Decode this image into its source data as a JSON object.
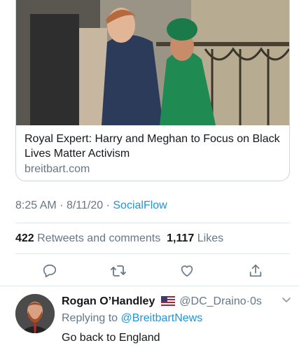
{
  "card": {
    "image_alt": "Harry and Meghan photo",
    "title": "Royal Expert: Harry and Meghan to Focus on Black Lives Matter Activism",
    "domain": "breitbart.com"
  },
  "meta": {
    "time": "8:25 AM",
    "date": "8/11/20",
    "separator": "·",
    "source": "SocialFlow"
  },
  "stats": {
    "retweets_count": "422",
    "retweets_label": "Retweets and comments",
    "likes_count": "1,117",
    "likes_label": "Likes"
  },
  "actions": [
    {
      "icon": "reply-icon"
    },
    {
      "icon": "retweet-icon"
    },
    {
      "icon": "like-icon"
    },
    {
      "icon": "share-icon"
    }
  ],
  "reply": {
    "name": "Rogan O’Handley",
    "flag_icon": "us-flag-icon",
    "handle": "@DC_Draino",
    "separator": "·",
    "time": "0s",
    "replying_prefix": "Replying to",
    "replying_to": "@BreitbartNews",
    "text": "Go back to England"
  },
  "colors": {
    "link": "#1b95e0",
    "secondary_text": "#657786",
    "border": "#e1e8ed"
  }
}
